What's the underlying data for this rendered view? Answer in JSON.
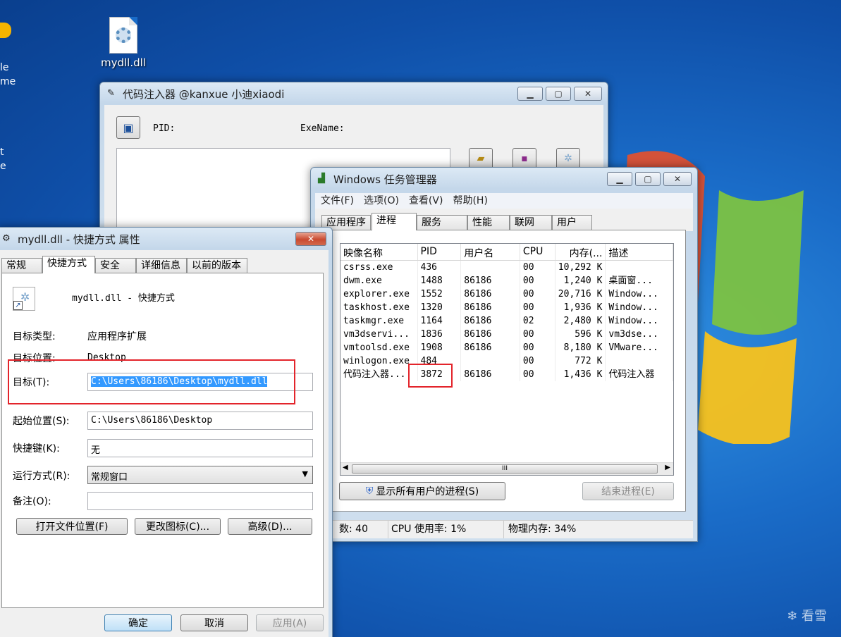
{
  "desktop": {
    "left_labels": [
      "le",
      "me",
      "t",
      "e"
    ],
    "file_icon_label": "mydll.dll",
    "watermark": "看雪"
  },
  "injector": {
    "title": "代码注入器 @kanxue 小迪xiaodi",
    "pid_label": "PID:",
    "exename_label": "ExeName:"
  },
  "properties": {
    "title": "mydll.dll - 快捷方式 属性",
    "tabs": [
      "常规",
      "快捷方式",
      "安全",
      "详细信息",
      "以前的版本"
    ],
    "active_tab": "快捷方式",
    "name": "mydll.dll - 快捷方式",
    "target_type_label": "目标类型:",
    "target_type": "应用程序扩展",
    "target_location_label": "目标位置:",
    "target_location": "Desktop",
    "target_label": "目标(T):",
    "target_value": "C:\\Users\\86186\\Desktop\\mydll.dll",
    "start_in_label": "起始位置(S):",
    "start_in_value": "C:\\Users\\86186\\Desktop",
    "shortcut_key_label": "快捷键(K):",
    "shortcut_key_value": "无",
    "run_label": "运行方式(R):",
    "run_value": "常规窗口",
    "comment_label": "备注(O):",
    "comment_value": "",
    "open_location_btn": "打开文件位置(F)",
    "change_icon_btn": "更改图标(C)...",
    "advanced_btn": "高级(D)...",
    "ok_btn": "确定",
    "cancel_btn": "取消",
    "apply_btn": "应用(A)"
  },
  "taskmgr": {
    "title": "Windows 任务管理器",
    "menu": [
      "文件(F)",
      "选项(O)",
      "查看(V)",
      "帮助(H)"
    ],
    "tabs": [
      "应用程序",
      "进程",
      "服务",
      "性能",
      "联网",
      "用户"
    ],
    "active_tab": "进程",
    "columns": [
      "映像名称",
      "PID",
      "用户名",
      "CPU",
      "内存(...",
      "描述"
    ],
    "rows": [
      [
        "csrss.exe",
        "436",
        "",
        "00",
        "10,292 K",
        ""
      ],
      [
        "dwm.exe",
        "1488",
        "86186",
        "00",
        "1,240 K",
        "桌面窗..."
      ],
      [
        "explorer.exe",
        "1552",
        "86186",
        "00",
        "20,716 K",
        "Window..."
      ],
      [
        "taskhost.exe",
        "1320",
        "86186",
        "00",
        "1,936 K",
        "Window..."
      ],
      [
        "taskmgr.exe",
        "1164",
        "86186",
        "02",
        "2,480 K",
        "Window..."
      ],
      [
        "vm3dservi...",
        "1836",
        "86186",
        "00",
        "596 K",
        "vm3dse..."
      ],
      [
        "vmtoolsd.exe",
        "1908",
        "86186",
        "00",
        "8,180 K",
        "VMware..."
      ],
      [
        "winlogon.exe",
        "484",
        "",
        "00",
        "772 K",
        ""
      ],
      [
        "代码注入器...",
        "3872",
        "86186",
        "00",
        "1,436 K",
        "代码注入器"
      ]
    ],
    "show_all_btn": "显示所有用户的进程(S)",
    "end_process_btn": "结束进程(E)",
    "status": {
      "processes": "数: 40",
      "cpu": "CPU 使用率: 1%",
      "memory": "物理内存: 34%"
    }
  },
  "colors": {
    "highlight": "#3399ff",
    "annotation_red": "#e3242b"
  }
}
